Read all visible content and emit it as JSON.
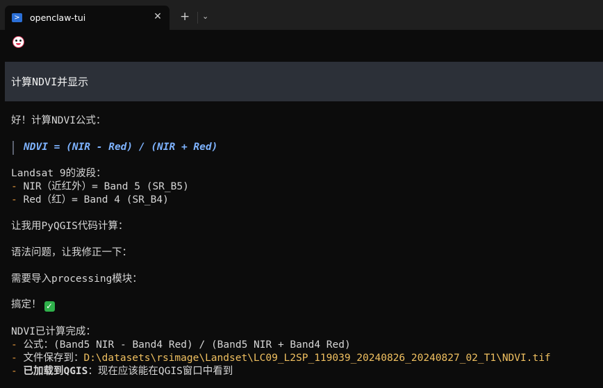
{
  "tab": {
    "title": "openclaw-tui",
    "close_label": "✕"
  },
  "tabbar": {
    "new_tab_label": "+",
    "dropdown_label": "⌄"
  },
  "icons": {
    "tab": "powershell-icon",
    "avatar": "lobster-icon",
    "done": "check-icon"
  },
  "prompt": {
    "text": "计算NDVI并显示"
  },
  "messages": {
    "intro": "好！计算NDVI公式：",
    "formula": "NDVI = (NIR - Red) / (NIR + Red)",
    "bands_title": "Landsat 9的波段：",
    "band_nir": "NIR（近红外）= Band 5 (SR_B5)",
    "band_red": "Red（红）= Band 4 (SR_B4)",
    "use_pyqgis": "让我用PyQGIS代码计算：",
    "syntax_fix": "语法问题，让我修正一下：",
    "need_import": "需要导入processing模块：",
    "done": "搞定！",
    "done_icon": "✓",
    "complete_title": "NDVI已计算完成：",
    "formula_label": "公式：",
    "formula_value": "(Band5 NIR - Band4 Red) / (Band5 NIR + Band4 Red)",
    "saved_label": "文件保存到：",
    "saved_path": "D:\\datasets\\rsimage\\Landset\\LC09_L2SP_119039_20240826_20240827_02_T1\\NDVI.tif",
    "loaded_label": "已加载到QGIS",
    "loaded_value": "：现在应该能在QGIS窗口中看到"
  },
  "colors": {
    "accent_dash": "#e89a3c",
    "formula": "#7eb3ff",
    "path": "#f0c060",
    "prompt_bg": "#2c3038"
  }
}
